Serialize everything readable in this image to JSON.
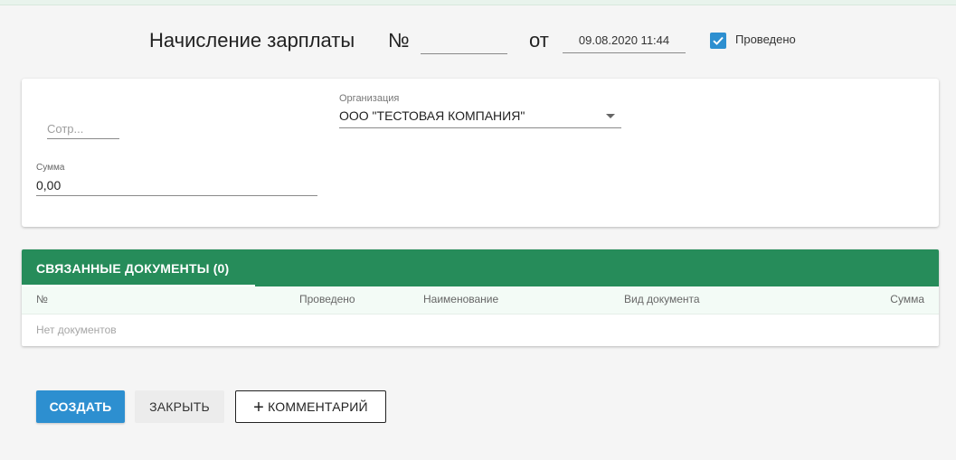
{
  "header": {
    "title": "Начисление зарплаты",
    "number_sign": "№",
    "number_value": "",
    "from_label": "от",
    "date_value": "09.08.2020 11:44",
    "posted_label": "Проведено",
    "posted_checked": true
  },
  "form": {
    "employee_placeholder": "Сотр...",
    "organization_label": "Организация",
    "organization_value": "ООО \"ТЕСТОВАЯ КОМПАНИЯ\"",
    "sum_label": "Сумма",
    "sum_value": "0,00"
  },
  "related": {
    "tab_label": "СВЯЗАННЫЕ ДОКУМЕНТЫ (0)",
    "columns": [
      "№",
      "Проведено",
      "Наименование",
      "Вид документа",
      "Сумма"
    ],
    "empty_text": "Нет документов"
  },
  "actions": {
    "create_label": "СОЗДАТЬ",
    "close_label": "ЗАКРЫТЬ",
    "comment_icon": "+",
    "comment_label": "КОММЕНТАРИЙ"
  },
  "colors": {
    "accent_blue": "#2d8fd0",
    "tab_green": "#268c5a",
    "background": "#f5f5f5"
  }
}
